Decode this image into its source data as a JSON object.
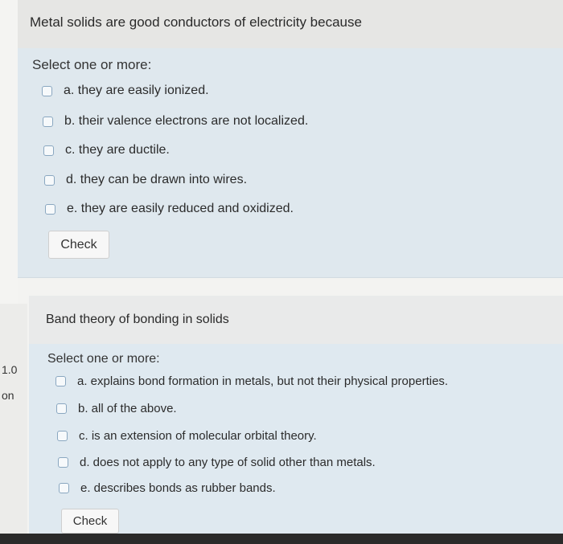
{
  "side": {
    "grade": "1.0",
    "flag": "on"
  },
  "question1": {
    "text": "Metal solids are good conductors of electricity because",
    "prompt": "Select one or more:",
    "options": [
      "a. they are easily ionized.",
      "b. their valence electrons are not localized.",
      "c. they are ductile.",
      "d. they can be drawn into wires.",
      "e. they are easily reduced and oxidized."
    ],
    "check_label": "Check"
  },
  "question2": {
    "text": "Band theory of bonding in solids",
    "prompt": "Select one or more:",
    "options": [
      "a. explains bond formation in metals, but not their physical properties.",
      "b. all of the above.",
      "c. is an extension of molecular orbital theory.",
      "d. does not apply to any type of solid other than metals.",
      "e. describes bonds as rubber bands."
    ],
    "check_label": "Check"
  }
}
